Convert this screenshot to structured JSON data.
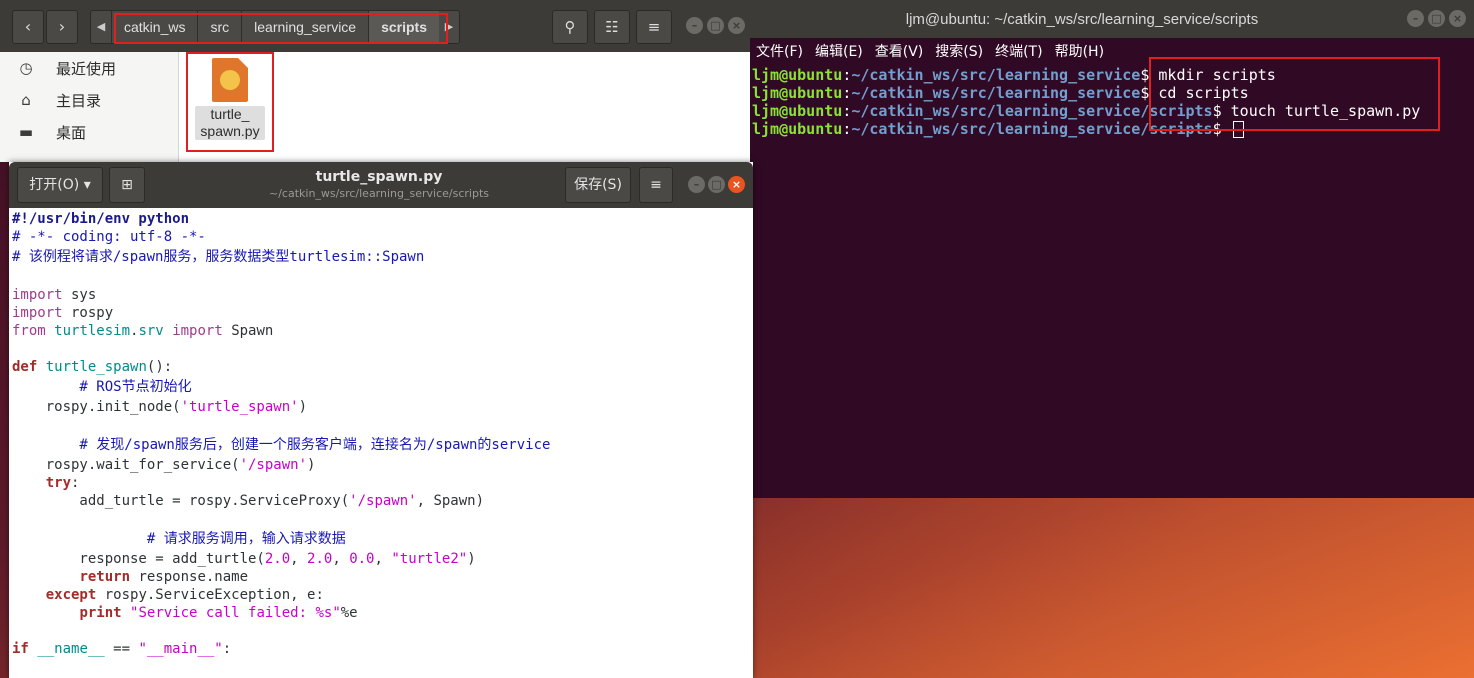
{
  "terminal": {
    "title": "ljm@ubuntu: ~/catkin_ws/src/learning_service/scripts",
    "menu": [
      "文件(F)",
      "编辑(E)",
      "查看(V)",
      "搜索(S)",
      "终端(T)",
      "帮助(H)"
    ],
    "lines": [
      {
        "user": "ljm@ubuntu",
        "path": "~/catkin_ws/src/learning_service",
        "cmd": "mkdir scripts"
      },
      {
        "user": "ljm@ubuntu",
        "path": "~/catkin_ws/src/learning_service",
        "cmd": "cd scripts"
      },
      {
        "user": "ljm@ubuntu",
        "path": "~/catkin_ws/src/learning_service/scripts",
        "cmd": "touch turtle_spawn.py"
      },
      {
        "user": "ljm@ubuntu",
        "path": "~/catkin_ws/src/learning_service/scripts",
        "cmd": ""
      }
    ]
  },
  "files": {
    "breadcrumb": [
      "catkin_ws",
      "src",
      "learning_service",
      "scripts"
    ],
    "sidebar": [
      "最近使用",
      "主目录",
      "桌面"
    ],
    "file_name_line1": "turtle_",
    "file_name_line2": "spawn.py"
  },
  "gedit": {
    "open_label": "打开(O)",
    "save_label": "保存(S)",
    "title": "turtle_spawn.py",
    "subtitle": "~/catkin_ws/src/learning_service/scripts"
  },
  "code_lines": [
    "#!/usr/bin/env python",
    "# -*- coding: utf-8 -*-",
    "# 该例程将请求/spawn服务，服务数据类型turtlesim::Spawn",
    "",
    "import sys",
    "import rospy",
    "from turtlesim.srv import Spawn",
    "",
    "def turtle_spawn():",
    "        # ROS节点初始化",
    "    rospy.init_node('turtle_spawn')",
    "",
    "        # 发现/spawn服务后，创建一个服务客户端，连接名为/spawn的service",
    "    rospy.wait_for_service('/spawn')",
    "    try:",
    "        add_turtle = rospy.ServiceProxy('/spawn', Spawn)",
    "",
    "                # 请求服务调用，输入请求数据",
    "        response = add_turtle(2.0, 2.0, 0.0, \"turtle2\")",
    "        return response.name",
    "    except rospy.ServiceException, e:",
    "        print \"Service call failed: %s\"%e",
    "",
    "if __name__ == \"__main__\":"
  ]
}
